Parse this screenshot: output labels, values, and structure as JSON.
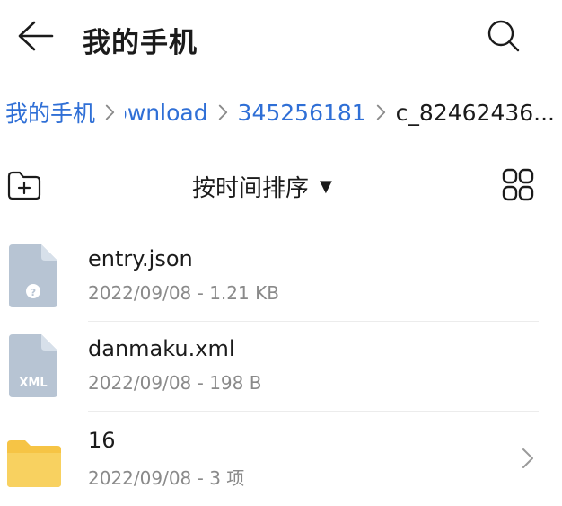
{
  "header": {
    "title": "我的手机"
  },
  "breadcrumb": {
    "items": [
      {
        "label": "我的手机"
      },
      {
        "label": "Download"
      },
      {
        "label": "345256181"
      },
      {
        "label": "c_82462436..."
      }
    ]
  },
  "toolbar": {
    "sort_label": "按时间排序",
    "sort_caret": "▼"
  },
  "files": [
    {
      "name": "entry.json",
      "meta": "2022/09/08 - 1.21 KB",
      "icon": "unknown-file-icon",
      "icon_text": "?"
    },
    {
      "name": "danmaku.xml",
      "meta": "2022/09/08 - 198 B",
      "icon": "xml-file-icon",
      "icon_text": "XML"
    },
    {
      "name": "16",
      "meta": "2022/09/08 - 3 项",
      "icon": "folder-icon"
    }
  ],
  "colors": {
    "link": "#2f6fd6",
    "file_icon": "#b7c4d3",
    "folder": "#f6c445"
  }
}
